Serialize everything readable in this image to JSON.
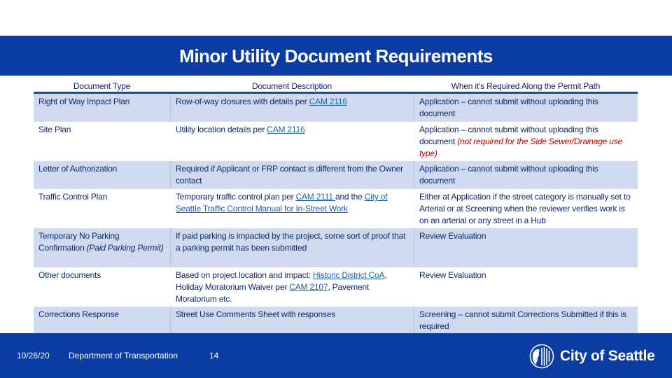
{
  "title": "Minor Utility Document Requirements",
  "table": {
    "headers": [
      "Document Type",
      "Document Description",
      "When it’s Required Along the Permit Path"
    ],
    "rows": [
      {
        "type": "Right of Way Impact Plan",
        "description": {
          "pre": "Row-of-way closures with details per ",
          "link1": "CAM 2116",
          "mid": "",
          "link2": "",
          "post": ""
        },
        "when": {
          "text": "Application – cannot submit without uploading this document",
          "note": ""
        }
      },
      {
        "type": "Site Plan",
        "description": {
          "pre": "Utility location details per ",
          "link1": "CAM 2116",
          "mid": "",
          "link2": "",
          "post": ""
        },
        "when": {
          "text": "Application – cannot submit without uploading this document ",
          "note": "(not required for the Side Sewer/Drainage use type)"
        }
      },
      {
        "type": "Letter of Authorization",
        "description": {
          "pre": "Required if Applicant or FRP contact is different from the Owner contact",
          "link1": "",
          "mid": "",
          "link2": "",
          "post": ""
        },
        "when": {
          "text": "Application – cannot submit without uploading this document",
          "note": ""
        }
      },
      {
        "type": "Traffic Control Plan",
        "description": {
          "pre": "Temporary traffic control plan per ",
          "link1": "CAM 2111 ",
          "mid": "and the ",
          "link2": "City of Seattle Traffic Control Manual for In-Street Work",
          "post": ""
        },
        "when": {
          "text": "Either at Application if the street category is manually set to Arterial or at Screening when the reviewer verifies work is on an arterial or any street in a Hub",
          "note": ""
        }
      },
      {
        "type": "Temporary No Parking Confirmation ",
        "type_note": "(Paid Parking Permit)",
        "description": {
          "pre": "If paid parking is impacted by the project, some sort of proof that a parking permit has been submitted",
          "link1": "",
          "mid": "",
          "link2": "",
          "post": ""
        },
        "when": {
          "text": "Review Evaluation",
          "note": ""
        }
      },
      {
        "type": "Other documents",
        "description": {
          "pre": "Based on project location and impact: ",
          "link1": "Historic District CoA",
          "mid": ", Holiday Moratorium Waiver per ",
          "link2": "CAM 2107",
          "post": ", Pavement Moratorium etc."
        },
        "when": {
          "text": "Review Evaluation",
          "note": ""
        }
      },
      {
        "type": "Corrections Response",
        "description": {
          "pre": "Street Use Comments Sheet with responses",
          "link1": "",
          "mid": "",
          "link2": "",
          "post": ""
        },
        "when": {
          "text": "Screening – cannot submit Corrections Submitted if this is required",
          "note": ""
        }
      }
    ]
  },
  "footer": {
    "date": "10/26/20",
    "department": "Department of Transportation",
    "page_number": "14",
    "logo_text": "City of Seattle",
    "logo_icon": "city-seal-icon"
  },
  "colors": {
    "brand_blue": "#0a3ca3",
    "row_shade": "#cfdaef",
    "text": "#0d2a6b",
    "link": "#1f5fa8",
    "note_red": "#c00000"
  }
}
